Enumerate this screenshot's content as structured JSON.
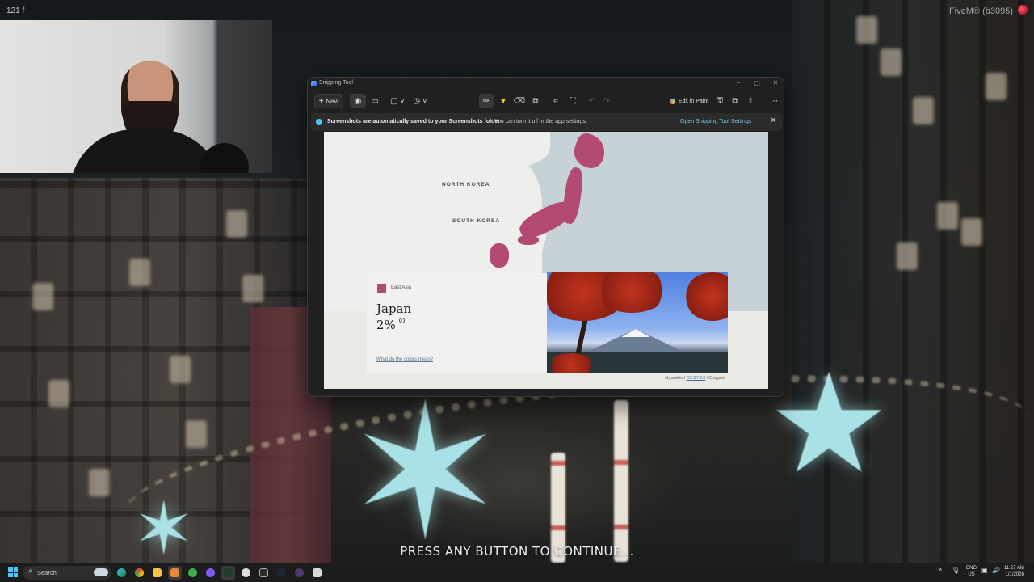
{
  "overlay": {
    "top_left": "121 f",
    "top_right": "FiveM® (b3095)",
    "prompt": "PRESS ANY BUTTON TO CONTINUE..."
  },
  "snipping_tool": {
    "title": "Snipping Tool",
    "toolbar": {
      "new_label": "New",
      "edit_in_paint_label": "Edit in Paint"
    },
    "info_bar": {
      "bold_text": "Screenshots are automatically saved to your Screenshots folder",
      "text": "You can turn it off in the app settings.",
      "link": "Open Snipping Tool Settings"
    },
    "capture": {
      "map_labels": [
        "NORTH KOREA",
        "SOUTH KOREA"
      ],
      "card": {
        "region": "East Asia",
        "country": "Japan",
        "percent": "2%",
        "info_symbol": "i",
        "colors_link": "What do the colors mean?"
      },
      "credit": {
        "author": "skyseeker",
        "license": "CC BY 2.0",
        "note": "Cropped"
      }
    }
  },
  "taskbar": {
    "search_placeholder": "Search",
    "language": "ENG",
    "region": "US",
    "time": "11:27 AM",
    "date": "1/1/2026"
  },
  "colors": {
    "japan_highlight": "#b24a74",
    "accent": "#4cc2ff",
    "link": "#74c7ef"
  }
}
